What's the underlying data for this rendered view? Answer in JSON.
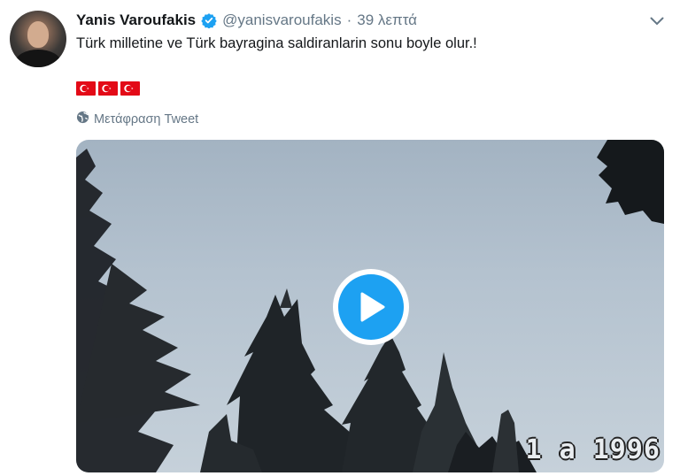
{
  "tweet": {
    "author_name": "Yanis Varoufakis",
    "handle": "@yanisvaroufakis",
    "separator": "·",
    "time": "39 λεπτά",
    "text": "Türk milletine ve Türk bayragina saldiranlarin sonu boyle olur.!",
    "flags": [
      "turkey-flag",
      "turkey-flag",
      "turkey-flag"
    ],
    "translate_label": "Μετάφραση Tweet"
  },
  "media": {
    "type": "video",
    "date_stamp": "1 a 1996"
  },
  "colors": {
    "accent": "#1da1f2",
    "secondary_text": "#657786",
    "flag_red": "#e30a17"
  },
  "icons": {
    "verified": "verified-badge-icon",
    "caret": "chevron-down-icon",
    "translate": "globe-icon",
    "play": "play-icon"
  }
}
